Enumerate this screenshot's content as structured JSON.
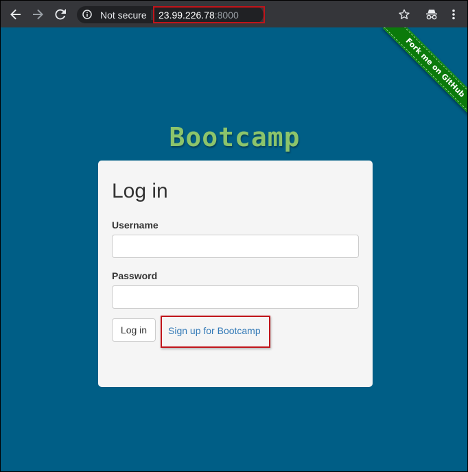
{
  "browser": {
    "security_label": "Not secure",
    "url_host": "23.99.226.78",
    "url_port": ":8000",
    "icons": [
      "back-arrow-icon",
      "forward-arrow-icon",
      "reload-icon",
      "info-icon",
      "star-icon",
      "incognito-icon",
      "more-vert-icon"
    ]
  },
  "ribbon": {
    "text": "Fork me on GitHub",
    "color": "#0b7a0b"
  },
  "brand": {
    "title": "Bootcamp",
    "color": "#8cc46b"
  },
  "form": {
    "heading": "Log in",
    "username_label": "Username",
    "username_value": "",
    "password_label": "Password",
    "password_value": "",
    "login_button": "Log in",
    "signup_link": "Sign up for Bootcamp"
  },
  "colors": {
    "page_bg": "#005e86",
    "highlight": "#c0141a",
    "link": "#337ab7"
  }
}
